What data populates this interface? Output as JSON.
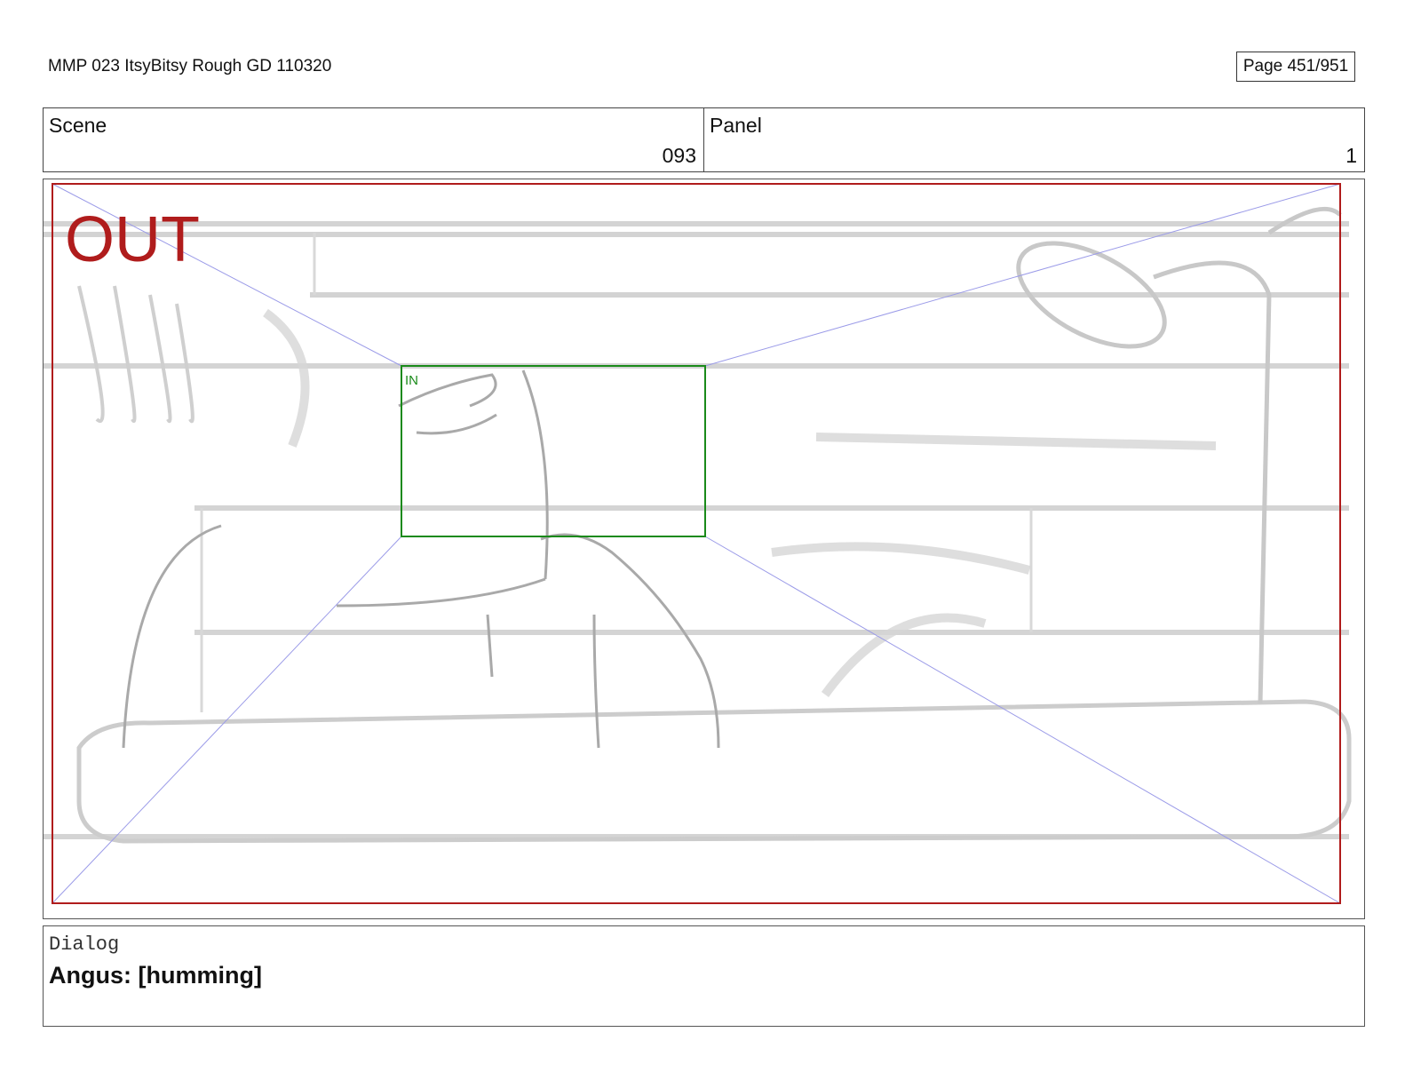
{
  "document": {
    "title": "MMP 023 ItsyBitsy Rough GD 110320",
    "page": "Page 451/951"
  },
  "header": {
    "scene_label": "Scene",
    "scene_value": "093",
    "panel_label": "Panel",
    "panel_value": "1"
  },
  "frame": {
    "out_label": "OUT",
    "in_label": "IN",
    "colors": {
      "out": "#b01c1c",
      "in": "#1a8a1a",
      "guides": "#9b9be8",
      "sketch": "#bdbdbd"
    }
  },
  "dialog": {
    "label": "Dialog",
    "text": "Angus: [humming]"
  }
}
